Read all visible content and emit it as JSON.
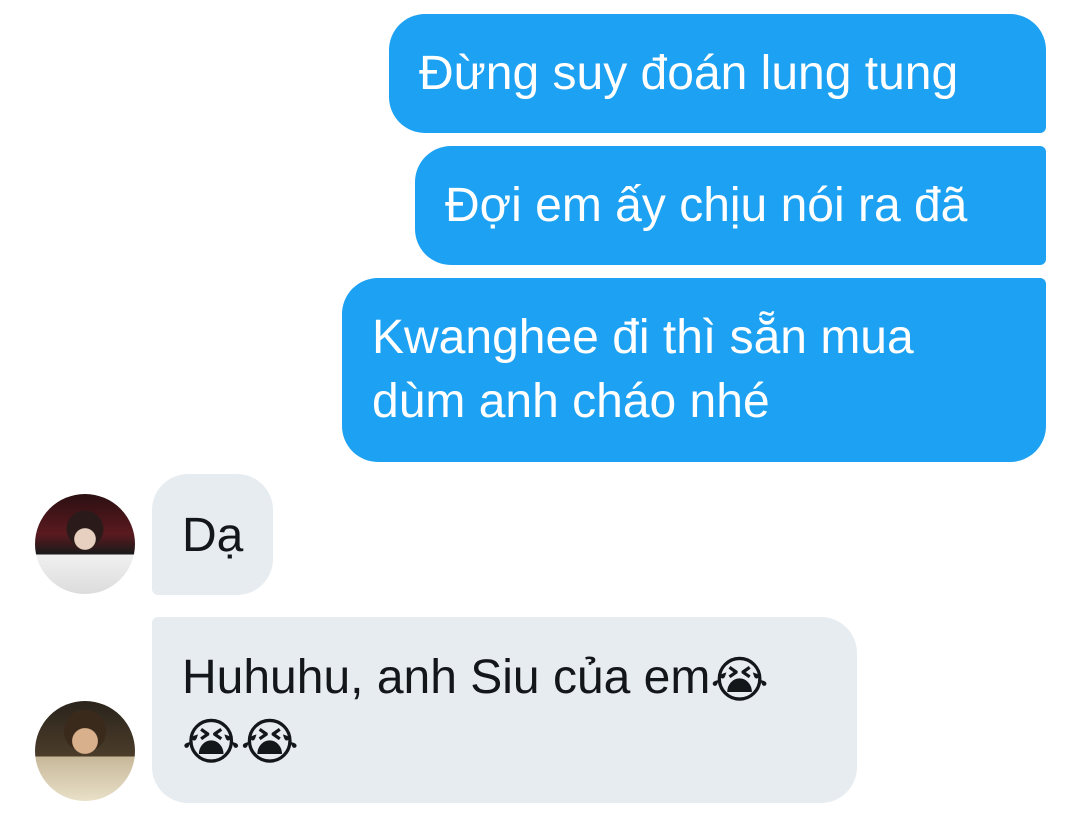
{
  "conversation": {
    "outgoing": [
      {
        "text": "Đừng suy đoán lung tung"
      },
      {
        "text": "Đợi em ấy chịu nói ra đã"
      },
      {
        "text": "Kwanghee đi thì sẵn mua dùm anh cháo nhé"
      }
    ],
    "incoming": [
      {
        "text": "Dạ",
        "avatar": "user-avatar-photo"
      },
      {
        "text": "Huhuhu, anh Siu của em",
        "emoji": [
          "😭",
          "😭",
          "😭"
        ],
        "avatar": "user-avatar-photo"
      }
    ]
  },
  "colors": {
    "outgoing_bubble": "#1da1f2",
    "incoming_bubble": "#e6ecf0",
    "incoming_text": "#14171a",
    "outgoing_text": "#ffffff"
  }
}
